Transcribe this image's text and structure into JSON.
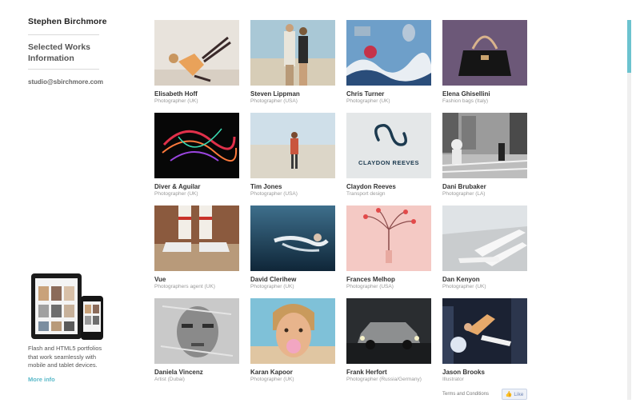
{
  "site": {
    "title": "Stephen Birchmore",
    "nav": [
      "Selected Works",
      "Information"
    ],
    "email": "studio@sbirchmore.com"
  },
  "promo": {
    "text": "Flash and HTML5 portfolios that work seamlessly with mobile and tablet devices.",
    "link": "More info"
  },
  "portfolio": [
    {
      "name": "Elisabeth Hoff",
      "role": "Photographer (UK)"
    },
    {
      "name": "Steven Lippman",
      "role": "Photographer (USA)"
    },
    {
      "name": "Chris Turner",
      "role": "Photographer (UK)"
    },
    {
      "name": "Elena Ghisellini",
      "role": "Fashion bags (Italy)"
    },
    {
      "name": "Diver & Aguilar",
      "role": "Photographer (UK)"
    },
    {
      "name": "Tim Jones",
      "role": "Photographer (USA)"
    },
    {
      "name": "Claydon Reeves",
      "role": "Transport design",
      "logo_text": "CLAYDON REEVES"
    },
    {
      "name": "Dani Brubaker",
      "role": "Photographer (LA)"
    },
    {
      "name": "Vue",
      "role": "Photographers agent (UK)"
    },
    {
      "name": "David Clerihew",
      "role": "Photographer (UK)"
    },
    {
      "name": "Frances Melhop",
      "role": "Photographer (USA)"
    },
    {
      "name": "Dan Kenyon",
      "role": "Photographer (UK)"
    },
    {
      "name": "Daniela Vincenz",
      "role": "Artist (Dubai)"
    },
    {
      "name": "Karan Kapoor",
      "role": "Photographer (UK)"
    },
    {
      "name": "Frank Herfort",
      "role": "Photographer (Russia/Germany)"
    },
    {
      "name": "Jason Brooks",
      "role": "Illustrator"
    }
  ],
  "footer": {
    "terms": "Terms and Conditions",
    "like": "Like"
  },
  "colors": {
    "accent": "#5ab9c9",
    "scrollbar": "#6cc3cf"
  }
}
